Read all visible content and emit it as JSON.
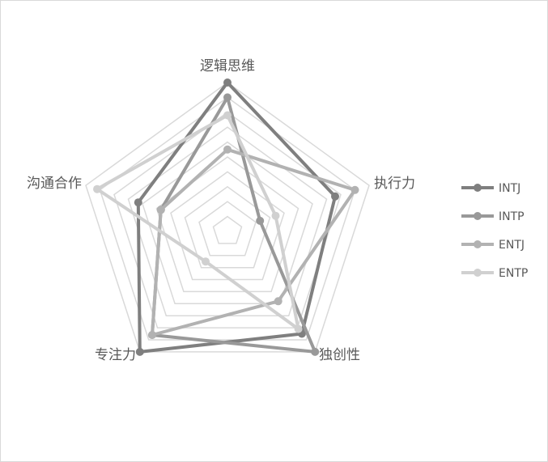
{
  "chart_data": {
    "type": "radar",
    "axes": [
      "逻辑思维",
      "执行力",
      "独创性",
      "专注力",
      "沟通合作"
    ],
    "r_range": [
      0,
      10
    ],
    "rings": 10,
    "grid": true,
    "legend_position": "right",
    "series": [
      {
        "name": "INTJ",
        "values": [
          10.0,
          7.6,
          8.5,
          10.0,
          6.3
        ],
        "color": "#7f7f7f"
      },
      {
        "name": "INTP",
        "values": [
          9.0,
          2.3,
          10.0,
          8.6,
          4.7
        ],
        "color": "#999999"
      },
      {
        "name": "ENTJ",
        "values": [
          5.5,
          9.0,
          5.8,
          8.6,
          4.7
        ],
        "color": "#b2b2b2"
      },
      {
        "name": "ENTP",
        "values": [
          7.8,
          3.4,
          8.1,
          2.5,
          9.2
        ],
        "color": "#d0d0d0"
      }
    ]
  }
}
